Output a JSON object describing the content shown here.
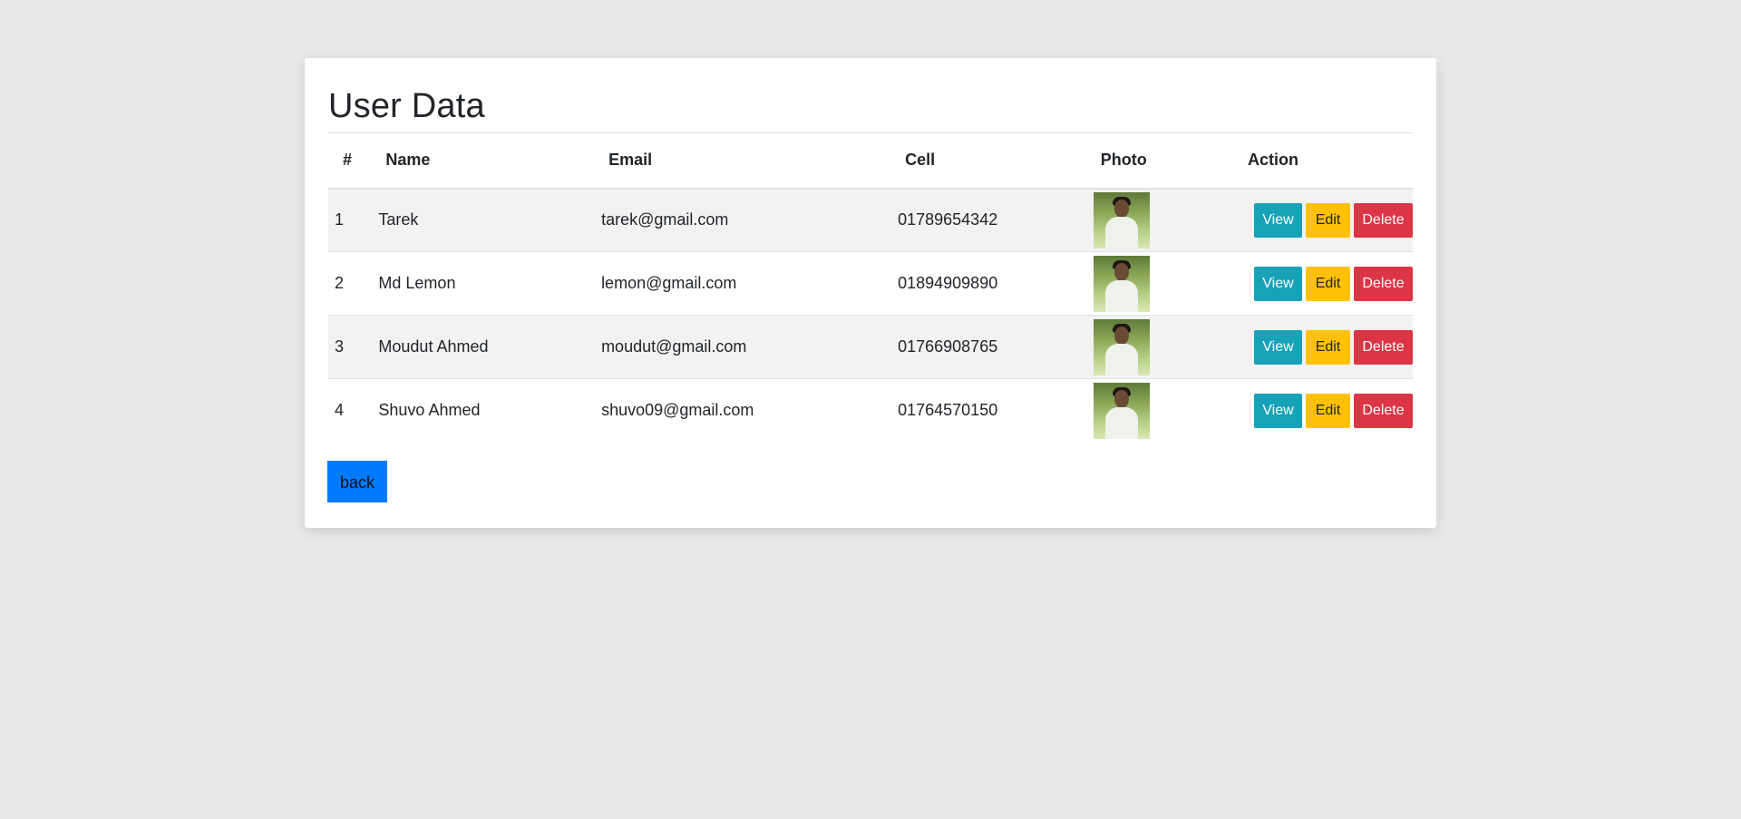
{
  "page": {
    "title": "User Data"
  },
  "table": {
    "headers": [
      "#",
      "Name",
      "Email",
      "Cell",
      "Photo",
      "Action"
    ],
    "rows": [
      {
        "num": "1",
        "name": "Tarek",
        "email": "tarek@gmail.com",
        "cell": "01789654342"
      },
      {
        "num": "2",
        "name": "Md Lemon",
        "email": "lemon@gmail.com",
        "cell": "01894909890"
      },
      {
        "num": "3",
        "name": "Moudut Ahmed",
        "email": "moudut@gmail.com",
        "cell": "01766908765"
      },
      {
        "num": "4",
        "name": "Shuvo Ahmed",
        "email": "shuvo09@gmail.com",
        "cell": "01764570150"
      }
    ]
  },
  "actions": {
    "view_label": "View",
    "edit_label": "Edit",
    "delete_label": "Delete"
  },
  "back_label": "back",
  "colors": {
    "view": "#17a2b8",
    "edit": "#ffc107",
    "delete": "#dc3545",
    "back": "#007bff",
    "page_bg": "#e8e8e8"
  }
}
